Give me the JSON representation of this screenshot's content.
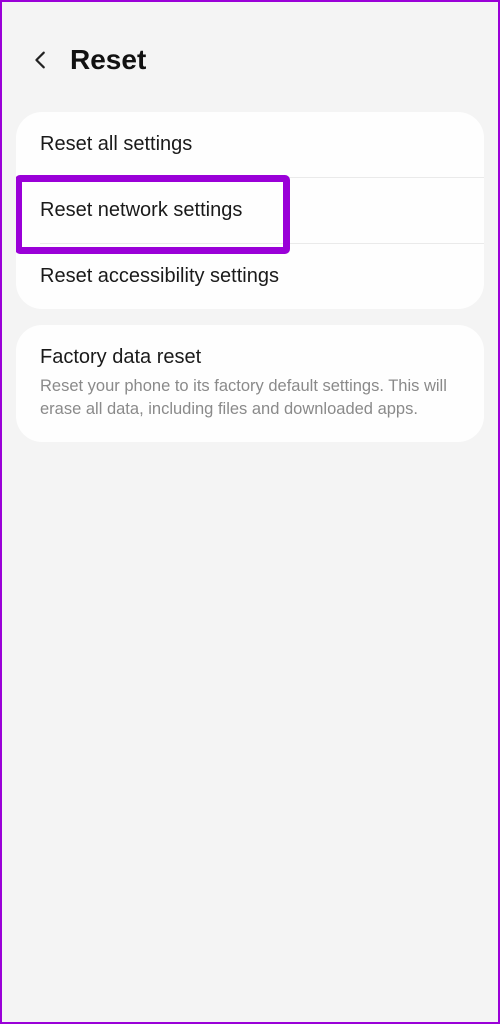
{
  "header": {
    "title": "Reset"
  },
  "group1": {
    "item1": {
      "title": "Reset all settings"
    },
    "item2": {
      "title": "Reset network settings"
    },
    "item3": {
      "title": "Reset accessibility settings"
    }
  },
  "group2": {
    "item1": {
      "title": "Factory data reset",
      "desc": "Reset your phone to its factory default settings. This will erase all data, including files and downloaded apps."
    }
  },
  "colors": {
    "accent": "#9a00d8"
  }
}
